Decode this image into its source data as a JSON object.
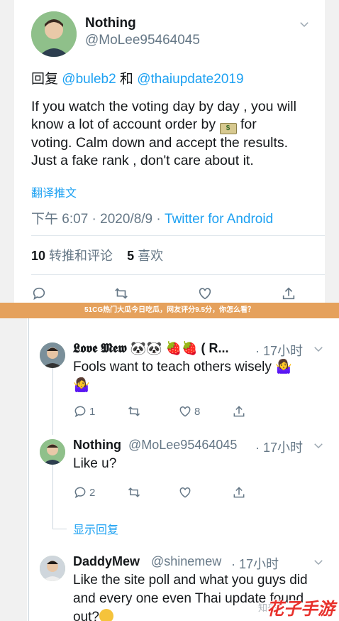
{
  "main_tweet": {
    "name": "Nothing",
    "handle": "@MoLee95464045",
    "reply_prefix": "回复",
    "mention_1": "@buleb2",
    "reply_and": "和",
    "mention_2": "@thaiupdate2019",
    "text_line1": "If you watch the voting day by day , you will",
    "text_line2a": "know a lot of account order by",
    "text_line2b": "for",
    "text_line3": "voting.  Calm down and accept the results.",
    "text_line4": "Just a fake rank , don't care about it.",
    "translate_label": "翻译推文",
    "time": "下午 6:07",
    "date": "2020/8/9",
    "source": "Twitter for Android",
    "retweets_count": "10",
    "retweets_label": "转推和评论",
    "likes_count": "5",
    "likes_label": "喜欢"
  },
  "banner": {
    "text": "51CG热门大瓜今日吃瓜，网友评分9.5分，你怎么看？"
  },
  "replies": [
    {
      "name": "𝕷𝖔𝖛𝖊 𝕸𝖊𝖜 🐼🐼 🍓🍓 ( R...",
      "time": "· 17小时",
      "text": "Fools want to teach others wisely 🤷‍♀️",
      "text2": "🤷‍♀️",
      "reply_count": "1",
      "like_count": "8"
    },
    {
      "name": "Nothing",
      "handle": "@MoLee95464045",
      "time": "· 17小时",
      "text": "Like u?",
      "reply_count": "2",
      "show_replies": "显示回复"
    },
    {
      "name": "DaddyMew",
      "handle": "@shinemew",
      "time": "· 17小时",
      "text_line1": "Like the site poll and what you guys did",
      "text_line2": "and every one even Thai update found",
      "text_line3": "out?"
    }
  ],
  "watermark_zh": "知乎",
  "watermark": "花子手游",
  "colors": {
    "accent": "#1da1f2",
    "muted": "#657786",
    "banner": "#e5a15c"
  },
  "icons": [
    "chevron-down-icon",
    "reply-icon",
    "retweet-icon",
    "like-icon",
    "share-icon",
    "money-icon"
  ]
}
